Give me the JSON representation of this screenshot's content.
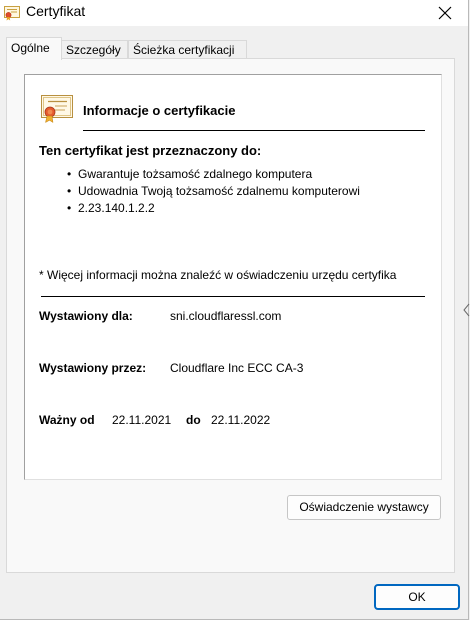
{
  "window": {
    "title": "Certyfikat",
    "icon": "certificate-icon",
    "close_icon": "close-icon"
  },
  "tabs": [
    {
      "label": "Ogólne",
      "active": true
    },
    {
      "label": "Szczegóły",
      "active": false
    },
    {
      "label": "Ścieżka certyfikacji",
      "active": false
    }
  ],
  "certificate": {
    "header_title": "Informacje o certyfikacie",
    "purpose_title": "Ten certyfikat jest przeznaczony do:",
    "purposes": [
      "Gwarantuje tożsamość zdalnego komputera",
      "Udowadnia Twoją tożsamość zdalnemu komputerowi",
      "2.23.140.1.2.2"
    ],
    "more_info": "* Więcej informacji można znaleźć w oświadczeniu urzędu certyfika",
    "issued_to_label": "Wystawiony dla:",
    "issued_to_value": "sni.cloudflaressl.com",
    "issued_by_label": "Wystawiony przez:",
    "issued_by_value": "Cloudflare Inc ECC CA-3",
    "valid_from_label": "Ważny od",
    "valid_from_value": "22.11.2021",
    "valid_to_label": "do",
    "valid_to_value": "22.11.2022"
  },
  "buttons": {
    "issuer_statement": "Oświadczenie wystawcy",
    "ok": "OK"
  },
  "colors": {
    "accent": "#0067c0",
    "dialog_bg": "#f0f0f0",
    "panel_bg": "#f9f9f9"
  }
}
